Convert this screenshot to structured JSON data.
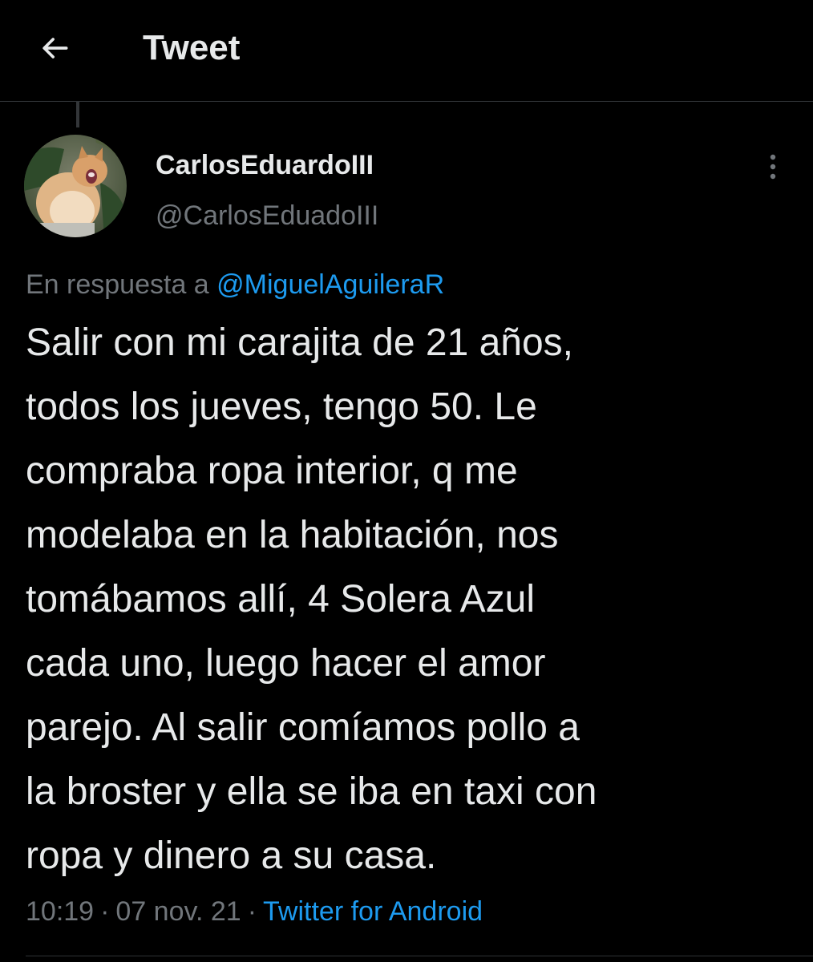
{
  "header": {
    "title": "Tweet",
    "back_icon": "arrow-left-icon"
  },
  "tweet": {
    "author": {
      "display_name": "CarlosEduardoIII",
      "handle": "@CarlosEduadoIII",
      "avatar": "cat-photo-avatar"
    },
    "reply_prefix": "En respuesta a",
    "reply_to": "@MiguelAguileraR",
    "text": "Salir con mi carajita de 21 años,\ntodos los jueves, tengo 50. Le\ncompraba ropa interior, q me\nmodelaba en la habitación, nos\ntomábamos allí, 4 Solera Azul\ncada uno, luego hacer el amor\nparejo. Al salir comíamos pollo a\nla broster y ella se iba en taxi con\nropa y dinero a su casa.",
    "time": "10:19",
    "date": "07 nov. 21",
    "separator": "·",
    "source": "Twitter for Android",
    "more_icon": "more-vertical-icon"
  },
  "colors": {
    "background": "#000000",
    "text": "#e7e9ea",
    "secondary": "#71767b",
    "accent": "#1d9bf0",
    "divider": "#2f3336"
  }
}
